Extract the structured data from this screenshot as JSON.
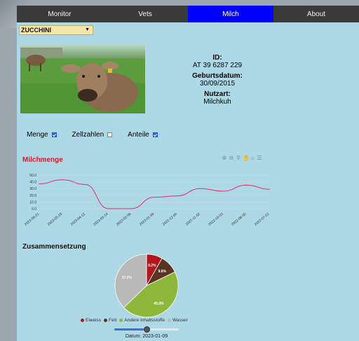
{
  "nav": {
    "items": [
      {
        "label": "Monitor",
        "active": false
      },
      {
        "label": "Vets",
        "active": false
      },
      {
        "label": "Milch",
        "active": true
      },
      {
        "label": "About",
        "active": false
      }
    ]
  },
  "cow_select": {
    "value": "ZUCCHINI"
  },
  "info": {
    "id_label": "ID:",
    "id_value": "AT 39 6287 229",
    "birth_label": "Geburtsdatum:",
    "birth_value": "30/09/2015",
    "use_label": "Nutzart:",
    "use_value": "Milchkuh"
  },
  "toggles": [
    {
      "label": "Menge",
      "checked": true
    },
    {
      "label": "Zellzahlen",
      "checked": false
    },
    {
      "label": "Anteile",
      "checked": true
    }
  ],
  "toolbar_icons": [
    "zoom-in-icon",
    "zoom-out-icon",
    "magnifier-icon",
    "pan-icon",
    "home-icon",
    "menu-icon"
  ],
  "colors": {
    "line": "#e0306a",
    "title_red": "#e0162b",
    "nav_active": "#0000ff"
  },
  "milk_chart": {
    "title": "Milchmenge",
    "chart_data": {
      "type": "line",
      "x_ticks": [
        "2023-06-21",
        "2023-05-19",
        "2023-04-12",
        "2023-03-14",
        "2023-02-06",
        "2023-01-09",
        "2022-12-05",
        "2022-11-02",
        "2022-10-03",
        "2022-08-30",
        "2022-07-22"
      ],
      "y_ticks": [
        "50.0",
        "40.0",
        "30.0",
        "20.0",
        "10.0",
        "0.0"
      ],
      "ylim": [
        0,
        50
      ],
      "values": [
        37,
        43,
        36,
        0,
        0,
        17,
        19,
        30,
        26,
        35,
        29
      ],
      "grid": true
    }
  },
  "composition": {
    "title": "Zusammensetzung",
    "chart_data": {
      "type": "pie",
      "slices": [
        {
          "name": "Eiweiss",
          "value": 8.2,
          "label": "8.2%",
          "color": "#b3151d"
        },
        {
          "name": "Fett",
          "value": 9.6,
          "label": "9.6%",
          "color": "#5a3422"
        },
        {
          "name": "Andere Inhaltsstoffe",
          "value": 45.0,
          "label": "45.0%",
          "color": "#8db83c"
        },
        {
          "name": "Wasser",
          "value": 37.2,
          "label": "37.2%",
          "color": "#b9b9b9"
        }
      ]
    }
  },
  "slider": {
    "position": 0.5,
    "label": "Datum: 2023-01-09"
  }
}
